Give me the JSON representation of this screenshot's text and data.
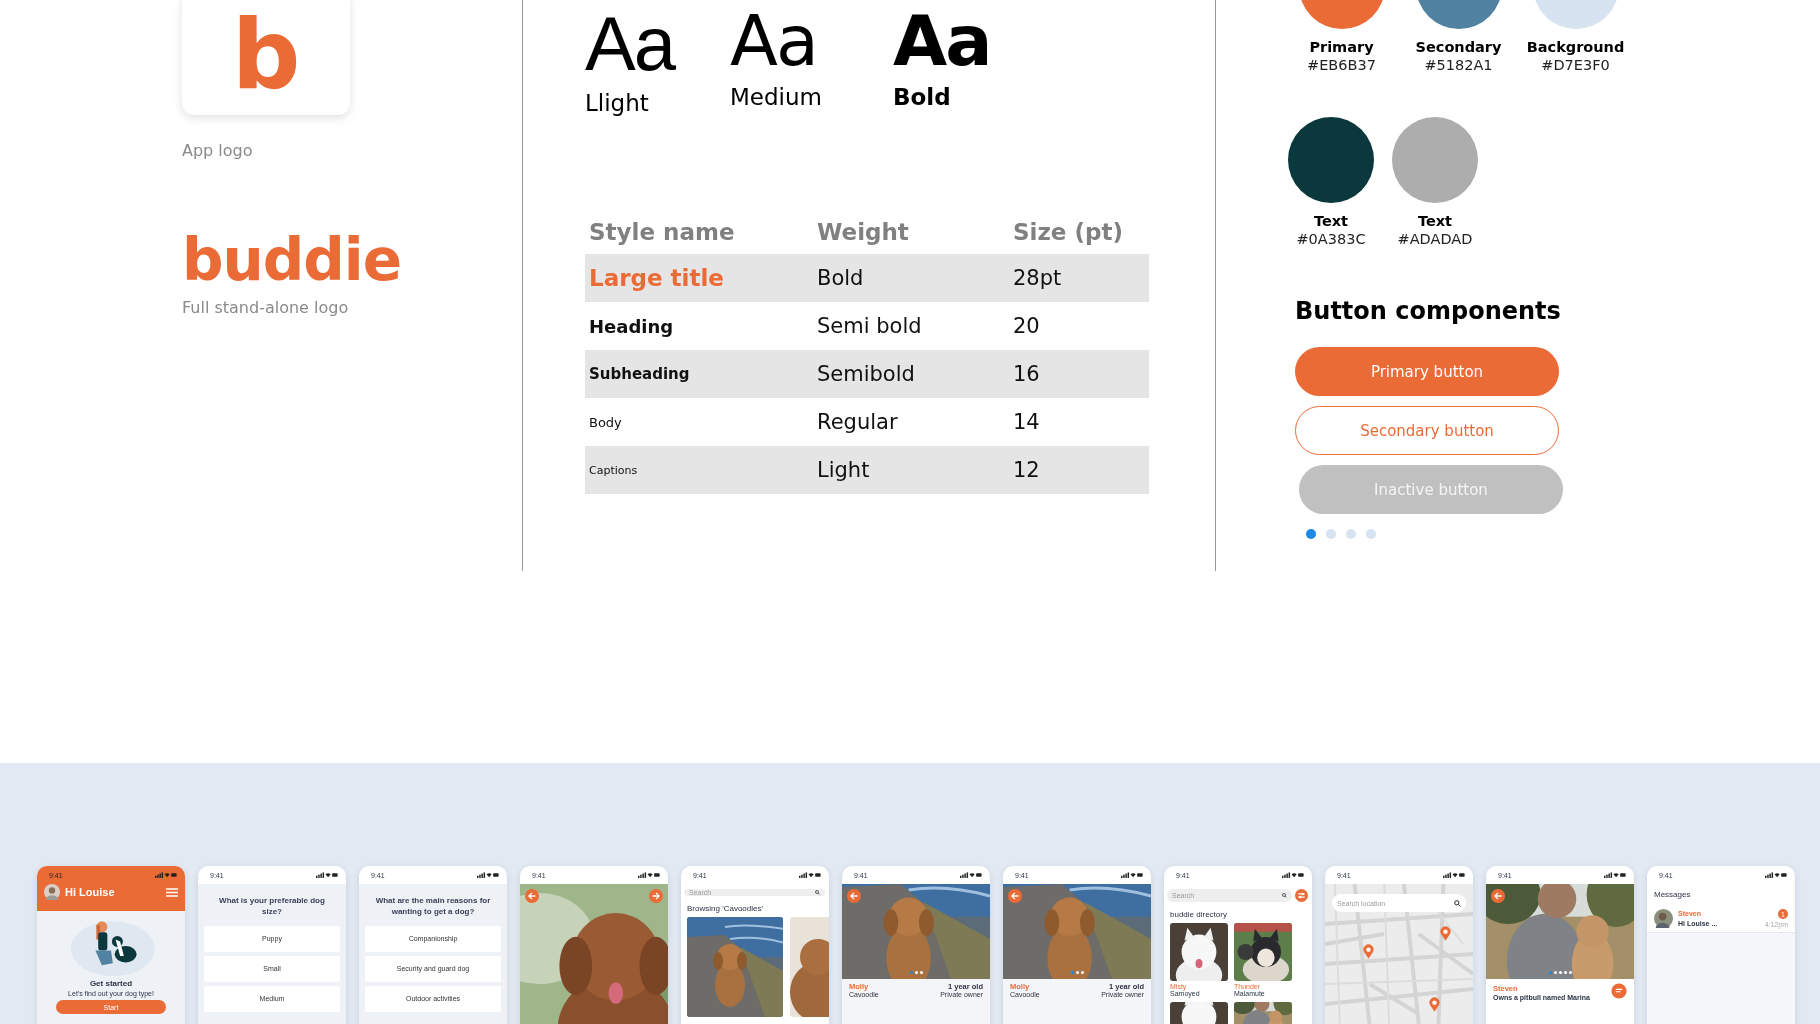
{
  "app_logo": {
    "glyph": "b",
    "caption": "App logo"
  },
  "wordmark": {
    "text": "buddie",
    "caption": "Full stand-alone logo"
  },
  "type_samples": [
    {
      "kind": "light",
      "sample": "Aa",
      "label": "Llight"
    },
    {
      "kind": "medium",
      "sample": "Aa",
      "label": "Medium"
    },
    {
      "kind": "bold",
      "sample": "Aa",
      "label": "Bold"
    }
  ],
  "type_table": {
    "columns": [
      "Style name",
      "Weight",
      "Size (pt)"
    ],
    "rows": [
      {
        "kind": "large_title",
        "style": "Large title",
        "weight": "Bold",
        "size": "28pt"
      },
      {
        "kind": "heading",
        "style": "Heading",
        "weight": "Semi bold",
        "size": "20"
      },
      {
        "kind": "subheading",
        "style": "Subheading",
        "weight": "Semibold",
        "size": "16"
      },
      {
        "kind": "body",
        "style": "Body",
        "weight": "Regular",
        "size": "14"
      },
      {
        "kind": "caption",
        "style": "Captions",
        "weight": "Light",
        "size": "12"
      }
    ]
  },
  "color_rows": [
    {
      "swatches": [
        {
          "name": "Primary",
          "hex": "#EB6B37",
          "color": "#eb6b37"
        },
        {
          "name": "Secondary",
          "hex": "#5182A1",
          "color": "#5182a1"
        },
        {
          "name": "Background",
          "hex": "#D7E3F0",
          "color": "#d7e3f0"
        }
      ]
    },
    {
      "swatches": [
        {
          "name": "Text",
          "hex": "#0A383C",
          "color": "#0a383c"
        },
        {
          "name": "Text",
          "hex": "#ADADAD",
          "color": "#adadad"
        }
      ]
    }
  ],
  "buttons": {
    "title": "Button components",
    "items": [
      {
        "kind": "primary",
        "label": "Primary button"
      },
      {
        "kind": "secondary",
        "label": "Secondary button"
      },
      {
        "kind": "inactive",
        "label": "Inactive button"
      }
    ]
  },
  "page_dots": [
    {
      "selected": true
    },
    {
      "selected": false
    },
    {
      "selected": false
    },
    {
      "selected": false
    }
  ],
  "screens": [
    {
      "kind": "home",
      "time": "9:41",
      "greeting": "Hi Louise",
      "title": "Get started",
      "subtitle": "Let's find out your dog type!",
      "button": "Start"
    },
    {
      "kind": "question",
      "time": "9:41",
      "question": "What is your preferable dog size?",
      "options": [
        "Puppy",
        "Small",
        "Medium"
      ]
    },
    {
      "kind": "question",
      "time": "9:41",
      "question": "What are the main reasons for wanting to get a dog?",
      "options": [
        "Companionship",
        "Security and guard dog",
        "Outdoor activities"
      ]
    },
    {
      "time": "9:41"
    },
    {
      "kind": "browse",
      "time": "9:41",
      "search_placeholder": "Search",
      "heading": "Browsing 'Cavoodles'"
    },
    {
      "kind": "dog_profile",
      "time": "9:41",
      "dots": [
        {
          "selected": true
        },
        {
          "selected": false
        },
        {
          "selected": false
        }
      ],
      "name": "Molly",
      "age": "1 year old",
      "breed": "Cavoodle",
      "owner": "Private owner"
    },
    {
      "kind": "dog_profile",
      "time": "9:41",
      "dots": [
        {
          "selected": true
        },
        {
          "selected": false
        },
        {
          "selected": false
        }
      ],
      "name": "Molly",
      "age": "1 year old",
      "breed": "Cavoodle",
      "owner": "Private owner"
    },
    {
      "kind": "directory",
      "time": "9:41",
      "search_placeholder": "Search",
      "heading": "buddie directory",
      "dogs": [
        {
          "name": "Misty",
          "breed": "Samoyed"
        },
        {
          "name": "Thunder",
          "breed": "Malamute"
        }
      ]
    },
    {
      "kind": "map",
      "time": "9:41",
      "search_placeholder": "Search location"
    },
    {
      "kind": "owner_profile",
      "time": "9:41",
      "dots": [
        {
          "selected": true
        },
        {
          "selected": false
        },
        {
          "selected": false
        },
        {
          "selected": false
        },
        {
          "selected": false
        }
      ],
      "name": "Steven",
      "bio": "Owns a pitbull named Marina"
    },
    {
      "kind": "messages",
      "time": "9:41",
      "title": "Messages",
      "conversations": [
        {
          "name": "Steven",
          "preview": "Hi Louise ...",
          "time": "4:12pm",
          "badge": "1"
        }
      ]
    }
  ]
}
